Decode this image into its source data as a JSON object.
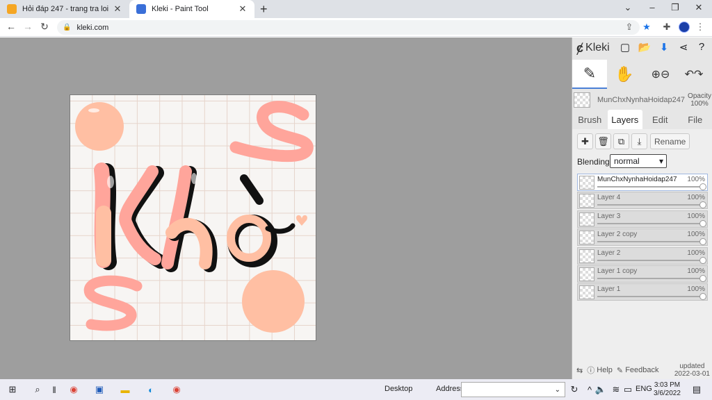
{
  "browser": {
    "tabs": [
      {
        "title": "Hỏi đáp 247 - trang tra loi",
        "active": false
      },
      {
        "title": "Kleki - Paint Tool",
        "active": true
      }
    ],
    "url": "kleki.com"
  },
  "kleki": {
    "app_name": "Kleki",
    "current_layer": {
      "name": "MunChxNynhaHoidap247",
      "opacity_label": "Opacity",
      "opacity_value": "100%"
    },
    "main_tabs": [
      {
        "label": "Brush",
        "selected": false
      },
      {
        "label": "Layers",
        "selected": true
      },
      {
        "label": "Edit",
        "selected": false
      },
      {
        "label": "File",
        "selected": false
      }
    ],
    "layer_tools": {
      "rename_label": "Rename"
    },
    "blending": {
      "label": "Blending",
      "value": "normal"
    },
    "layers": [
      {
        "name": "MunChxNynhaHoidap247",
        "opacity": "100%",
        "selected": true
      },
      {
        "name": "Layer 4",
        "opacity": "100%",
        "selected": false
      },
      {
        "name": "Layer 3",
        "opacity": "100%",
        "selected": false
      },
      {
        "name": "Layer 2 copy",
        "opacity": "100%",
        "selected": false
      },
      {
        "name": "Layer 2",
        "opacity": "100%",
        "selected": false
      },
      {
        "name": "Layer 1 copy",
        "opacity": "100%",
        "selected": false
      },
      {
        "name": "Layer 1",
        "opacity": "100%",
        "selected": false
      }
    ],
    "bottom": {
      "help": "Help",
      "feedback": "Feedback",
      "updated_label": "updated",
      "updated_date": "2022-03-01"
    },
    "artwork_text": "Khó"
  },
  "taskbar": {
    "desktop_label": "Desktop",
    "address_label": "Address",
    "lang": "ENG",
    "time": "3:03 PM",
    "date": "3/6/2022"
  },
  "colors": {
    "peach": "#ffbfa3",
    "pink": "#ffa59b",
    "accent": "#4a7fd6"
  }
}
